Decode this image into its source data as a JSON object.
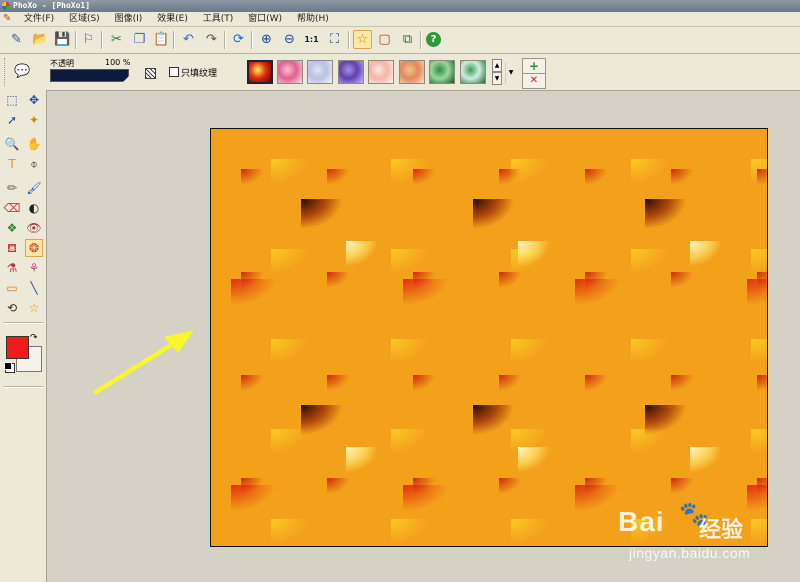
{
  "window": {
    "title": "PhoXo - [PhoXo1]"
  },
  "menu": {
    "items": [
      "文件(F)",
      "区域(S)",
      "图像(I)",
      "效果(E)",
      "工具(T)",
      "窗口(W)",
      "帮助(H)"
    ]
  },
  "toolbar": {
    "buttons": [
      {
        "name": "new-file-icon",
        "glyph": "✎"
      },
      {
        "name": "open-folder-icon",
        "glyph": "📂"
      },
      {
        "name": "save-icon",
        "glyph": "💾"
      },
      {
        "name": "scan-icon",
        "glyph": "⚐"
      },
      {
        "name": "cut-icon",
        "glyph": "✂"
      },
      {
        "name": "copy-icon",
        "glyph": "❐"
      },
      {
        "name": "paste-icon",
        "glyph": "📋"
      },
      {
        "name": "undo-icon",
        "glyph": "↶"
      },
      {
        "name": "redo-icon",
        "glyph": "↷"
      },
      {
        "name": "refresh-icon",
        "glyph": "⟳"
      },
      {
        "name": "zoom-in-icon",
        "glyph": "⊕"
      },
      {
        "name": "zoom-out-icon",
        "glyph": "⊖"
      },
      {
        "name": "actual-size-icon",
        "glyph": "1:1"
      },
      {
        "name": "fit-window-icon",
        "glyph": "⛶"
      },
      {
        "name": "effects-star-icon",
        "glyph": "☆"
      },
      {
        "name": "frame-icon",
        "glyph": "▢"
      },
      {
        "name": "layers-icon",
        "glyph": "⧉"
      },
      {
        "name": "help-icon",
        "glyph": "?"
      }
    ]
  },
  "options": {
    "opacity_label": "不透明",
    "opacity_value": "100 %",
    "opacity_level": 1.0,
    "fill_texture_label": "只填纹理",
    "fill_texture_checked": false,
    "add_glyph": "+",
    "delete_glyph": "✕",
    "swatches": [
      {
        "c1": "#ffef5a",
        "c2": "#e03010",
        "c3": "#5a0000",
        "selected": true
      },
      {
        "c1": "#f8c0d0",
        "c2": "#e06090",
        "c3": "#f4e0e8",
        "selected": false
      },
      {
        "c1": "#e0e4f4",
        "c2": "#b8c0e4",
        "c3": "#f2f4fb",
        "selected": false
      },
      {
        "c1": "#a890e0",
        "c2": "#6040b0",
        "c3": "#c8b8f0",
        "selected": false
      },
      {
        "c1": "#fde8e0",
        "c2": "#f4b4a4",
        "c3": "#fff6f2",
        "selected": false
      },
      {
        "c1": "#f8c090",
        "c2": "#e08858",
        "c3": "#fde0c8",
        "selected": false
      },
      {
        "c1": "#2e8a3e",
        "c2": "#9ad8a0",
        "c3": "#0f5a22",
        "selected": false
      },
      {
        "c1": "#3a9a5a",
        "c2": "#cfeedd",
        "c3": "#1a6a3a",
        "selected": false
      }
    ]
  },
  "tools": [
    {
      "name": "rect-select-tool-icon",
      "glyph": "⬚"
    },
    {
      "name": "move-tool-icon",
      "glyph": "✥"
    },
    {
      "name": "lasso-tool-icon",
      "glyph": "➚"
    },
    {
      "name": "magic-wand-tool-icon",
      "glyph": "✦"
    },
    {
      "name": "zoom-tool-icon",
      "glyph": "🔍"
    },
    {
      "name": "hand-tool-icon",
      "glyph": "✋"
    },
    {
      "name": "text-tool-icon",
      "glyph": "T"
    },
    {
      "name": "eyedropper-tool-icon",
      "glyph": "⌽"
    },
    {
      "name": "pencil-tool-icon",
      "glyph": "✏"
    },
    {
      "name": "brush-tool-icon",
      "glyph": "🖌"
    },
    {
      "name": "eraser-tool-icon",
      "glyph": "⌫"
    },
    {
      "name": "contrast-tool-icon",
      "glyph": "◐"
    },
    {
      "name": "clone-tool-icon",
      "glyph": "❖"
    },
    {
      "name": "red-eye-tool-icon",
      "glyph": "👁"
    },
    {
      "name": "fill-bucket-tool-icon",
      "glyph": "⛾"
    },
    {
      "name": "texture-fill-tool-icon",
      "glyph": "❂"
    },
    {
      "name": "color-replace-tool-icon",
      "glyph": "⚗"
    },
    {
      "name": "warp-tool-icon",
      "glyph": "⚘"
    },
    {
      "name": "gradient-tool-icon",
      "glyph": "▭"
    },
    {
      "name": "line-tool-icon",
      "glyph": "╲"
    },
    {
      "name": "transform-tool-icon",
      "glyph": "⟲"
    },
    {
      "name": "star-shape-tool-icon",
      "glyph": "☆"
    }
  ],
  "colors": {
    "foreground": "#f01c1c",
    "background": "#f4f2ec",
    "arrow": "#f7f72a"
  },
  "watermark": {
    "brand": "Bai",
    "paw": "🐾",
    "tag": "经验",
    "url": "jingyan.baidu.com"
  }
}
